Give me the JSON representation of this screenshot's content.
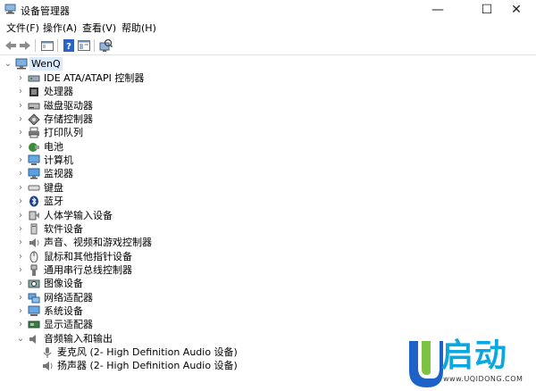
{
  "window": {
    "title": "设备管理器",
    "min": "—",
    "max": "☐",
    "close": "✕"
  },
  "menu": [
    {
      "label": "文件(F)"
    },
    {
      "label": "操作(A)"
    },
    {
      "label": "查看(V)"
    },
    {
      "label": "帮助(H)"
    }
  ],
  "toolbar": {
    "buttons": [
      "back-icon",
      "forward-icon",
      "properties-icon",
      "help-icon",
      "view-icon",
      "scan-icon"
    ]
  },
  "tree": {
    "root": "WenQ",
    "items": [
      {
        "label": "IDE ATA/ATAPI 控制器",
        "icon": "ide-controller-icon"
      },
      {
        "label": "处理器",
        "icon": "processor-icon"
      },
      {
        "label": "磁盘驱动器",
        "icon": "disk-drive-icon"
      },
      {
        "label": "存储控制器",
        "icon": "storage-controller-icon"
      },
      {
        "label": "打印队列",
        "icon": "printer-icon"
      },
      {
        "label": "电池",
        "icon": "battery-icon"
      },
      {
        "label": "计算机",
        "icon": "computer-icon"
      },
      {
        "label": "监视器",
        "icon": "monitor-icon"
      },
      {
        "label": "键盘",
        "icon": "keyboard-icon"
      },
      {
        "label": "蓝牙",
        "icon": "bluetooth-icon"
      },
      {
        "label": "人体学输入设备",
        "icon": "hid-icon"
      },
      {
        "label": "软件设备",
        "icon": "software-device-icon"
      },
      {
        "label": "声音、视频和游戏控制器",
        "icon": "sound-icon"
      },
      {
        "label": "鼠标和其他指针设备",
        "icon": "mouse-icon"
      },
      {
        "label": "通用串行总线控制器",
        "icon": "usb-icon"
      },
      {
        "label": "图像设备",
        "icon": "camera-icon"
      },
      {
        "label": "网络适配器",
        "icon": "network-adapter-icon"
      },
      {
        "label": "系统设备",
        "icon": "system-device-icon"
      },
      {
        "label": "显示适配器",
        "icon": "display-adapter-icon"
      },
      {
        "label": "音频输入和输出",
        "icon": "audio-io-icon",
        "expanded": true
      }
    ],
    "children": [
      {
        "label": "麦克风 (2- High Definition Audio 设备)",
        "icon": "microphone-icon"
      },
      {
        "label": "扬声器 (2- High Definition Audio 设备)",
        "icon": "speaker-icon"
      }
    ]
  },
  "watermark": {
    "brand": "启动",
    "url": "www.UQIDONG.COM"
  },
  "colors": {
    "selection": "#dcebfc",
    "brand": "#0aa7e0"
  }
}
